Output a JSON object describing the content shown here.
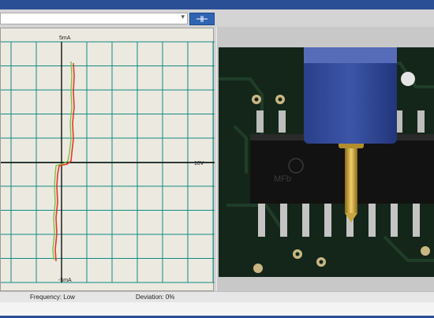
{
  "toolbar": {
    "dropdown_value": "",
    "tool_icon": "probe-symbol-icon"
  },
  "scope": {
    "top_label": "5mA",
    "bottom_label": "-5mA",
    "right_label": "10V",
    "trace_colors": {
      "trace_a": "#e8352a",
      "trace_b": "#7cc242"
    },
    "grid_color": "#0f8c83",
    "axis_color": "#111111"
  },
  "status": {
    "frequency": "Frequency: Low",
    "deviation": "Deviation: 0%"
  }
}
